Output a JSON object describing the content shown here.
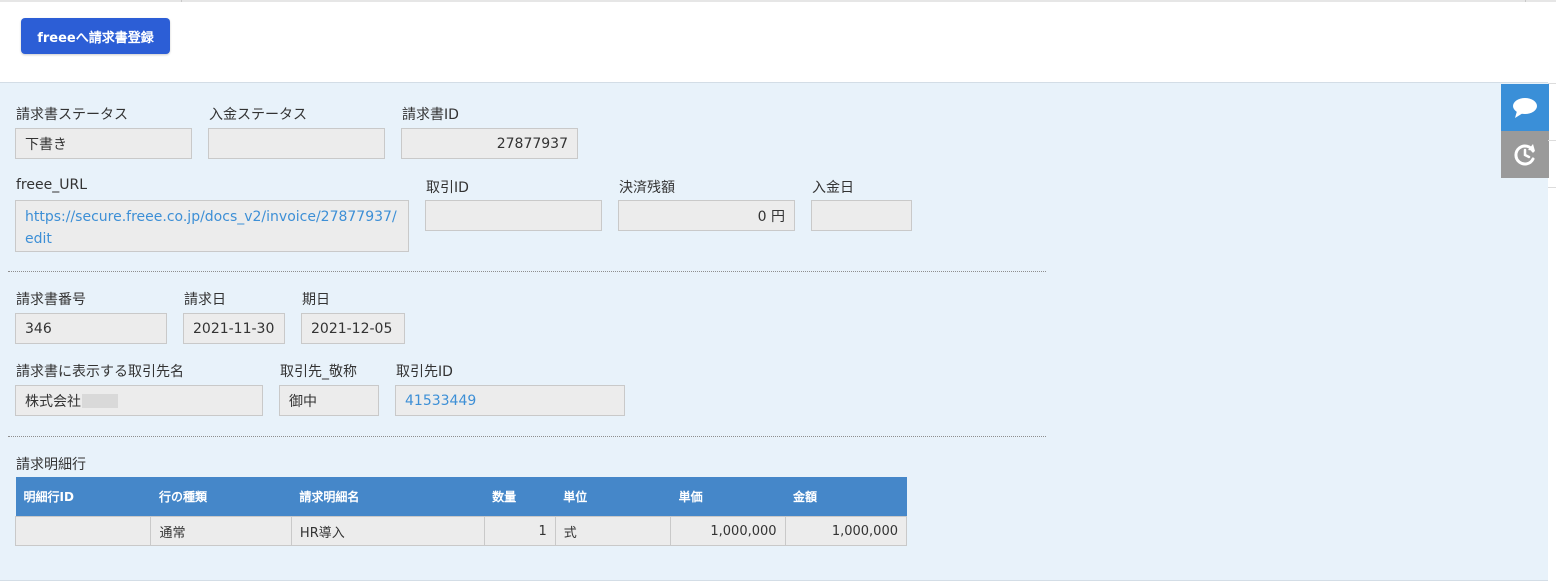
{
  "toolbar": {
    "register_label": "freeeへ請求書登録"
  },
  "invoice_status": {
    "status_label": "請求書ステータス",
    "status_value": "下書き",
    "payment_status_label": "入金ステータス",
    "payment_status_value": "",
    "invoice_id_label": "請求書ID",
    "invoice_id_value": "27877937"
  },
  "freee_info": {
    "url_label": "freee_URL",
    "url_value": "https://secure.freee.co.jp/docs_v2/invoice/27877937/edit",
    "deal_id_label": "取引ID",
    "deal_id_value": "",
    "balance_label": "決済残額",
    "balance_value": "0 円",
    "payment_date_label": "入金日",
    "payment_date_value": ""
  },
  "invoice_detail": {
    "number_label": "請求書番号",
    "number_value": "346",
    "issue_date_label": "請求日",
    "issue_date_value": "2021-11-30",
    "due_date_label": "期日",
    "due_date_value": "2021-12-05"
  },
  "partner": {
    "name_label": "請求書に表示する取引先名",
    "name_value": "株式会社",
    "honorific_label": "取引先_敬称",
    "honorific_value": "御中",
    "partner_id_label": "取引先ID",
    "partner_id_value": "41533449"
  },
  "line_items": {
    "section_label": "請求明細行",
    "columns": [
      "明細行ID",
      "行の種類",
      "請求明細名",
      "数量",
      "単位",
      "単価",
      "金額"
    ],
    "rows": [
      {
        "id": "",
        "type": "通常",
        "name": "HR導入",
        "qty": "1",
        "unit": "式",
        "unit_price": "1,000,000",
        "amount": "1,000,000"
      }
    ]
  },
  "side_buttons": {
    "chat_icon": "chat-bubble-icon",
    "refresh_icon": "history-refresh-icon"
  },
  "colors": {
    "primary_button": "#2c5ed6",
    "panel_bg": "#e8f2fa",
    "table_header": "#4587c9",
    "link": "#3d8fd6",
    "chat_button": "#3a8fd8",
    "refresh_button": "#9a9a9a"
  }
}
